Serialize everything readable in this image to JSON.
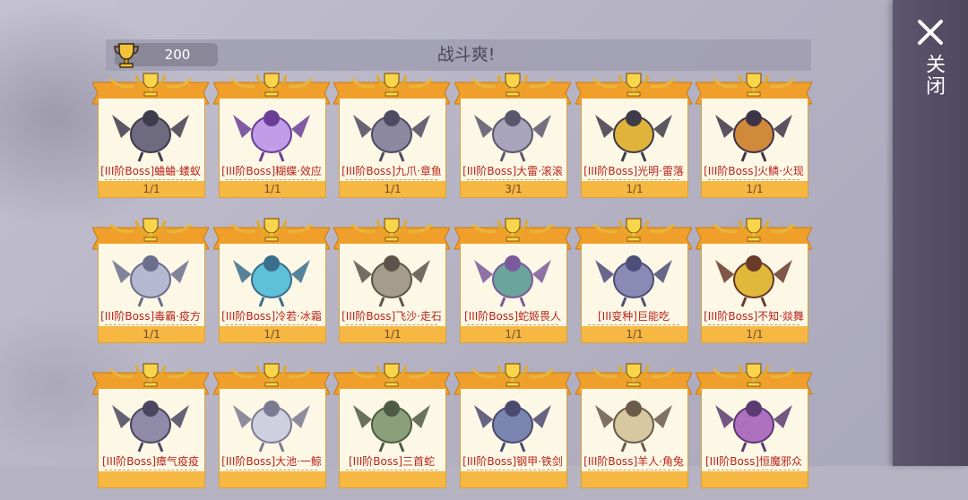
{
  "header": {
    "trophy_count": "200",
    "title": "战斗爽!"
  },
  "close": {
    "label": "关闭"
  },
  "colors": {
    "banner_orange": "#f0a02a",
    "card_bg": "#fdf8e6",
    "count_bar": "#f6b743",
    "name_red": "#b8241c",
    "panel": "#4d485e"
  },
  "cards": [
    {
      "name": "[III阶Boss]蛐蛐·蝼蚁",
      "count": "1/1",
      "icon": "mantis-boss-art"
    },
    {
      "name": "[III阶Boss]糊蝶·效应",
      "count": "1/1",
      "icon": "butterfly-boss-art"
    },
    {
      "name": "[III阶Boss]九爪·章鱼",
      "count": "1/1",
      "icon": "octopus-boss-art"
    },
    {
      "name": "[III阶Boss]大雷·滚滚",
      "count": "3/1",
      "icon": "thunder-boss-art"
    },
    {
      "name": "[III阶Boss]光明·雷落",
      "count": "1/1",
      "icon": "light-dragon-boss-art"
    },
    {
      "name": "[III阶Boss]火鳞·火现",
      "count": "1/1",
      "icon": "fire-dragon-boss-art"
    },
    {
      "name": "[III阶Boss]毒霸·疫方",
      "count": "1/1",
      "icon": "poison-dragon-boss-art"
    },
    {
      "name": "[III阶Boss]冷若·冰霜",
      "count": "1/1",
      "icon": "ice-dragon-boss-art"
    },
    {
      "name": "[III阶Boss]飞沙·走石",
      "count": "1/1",
      "icon": "sand-dragon-boss-art"
    },
    {
      "name": "[III阶Boss]蛇姬畏人",
      "count": "1/1",
      "icon": "medusa-boss-art"
    },
    {
      "name": "[III变种]巨能吃",
      "count": "1/1",
      "icon": "blob-boss-art"
    },
    {
      "name": "[III阶Boss]不知·燚舞",
      "count": "1/1",
      "icon": "flame-dancer-boss-art"
    },
    {
      "name": "[III阶Boss]瘴气疫疫",
      "count": "",
      "icon": "armored-boss-art"
    },
    {
      "name": "[III阶Boss]大池·一鲸",
      "count": "",
      "icon": "egg-boss-art"
    },
    {
      "name": "[III阶Boss]三首蛇",
      "count": "",
      "icon": "hydra-boss-art"
    },
    {
      "name": "[III阶Boss]钢甲·铁剑",
      "count": "",
      "icon": "knight-boss-art"
    },
    {
      "name": "[III阶Boss]羊人·角兔",
      "count": "",
      "icon": "goat-boss-art"
    },
    {
      "name": "[III阶Boss]恒魔邪众",
      "count": "",
      "icon": "bat-boss-art"
    }
  ]
}
